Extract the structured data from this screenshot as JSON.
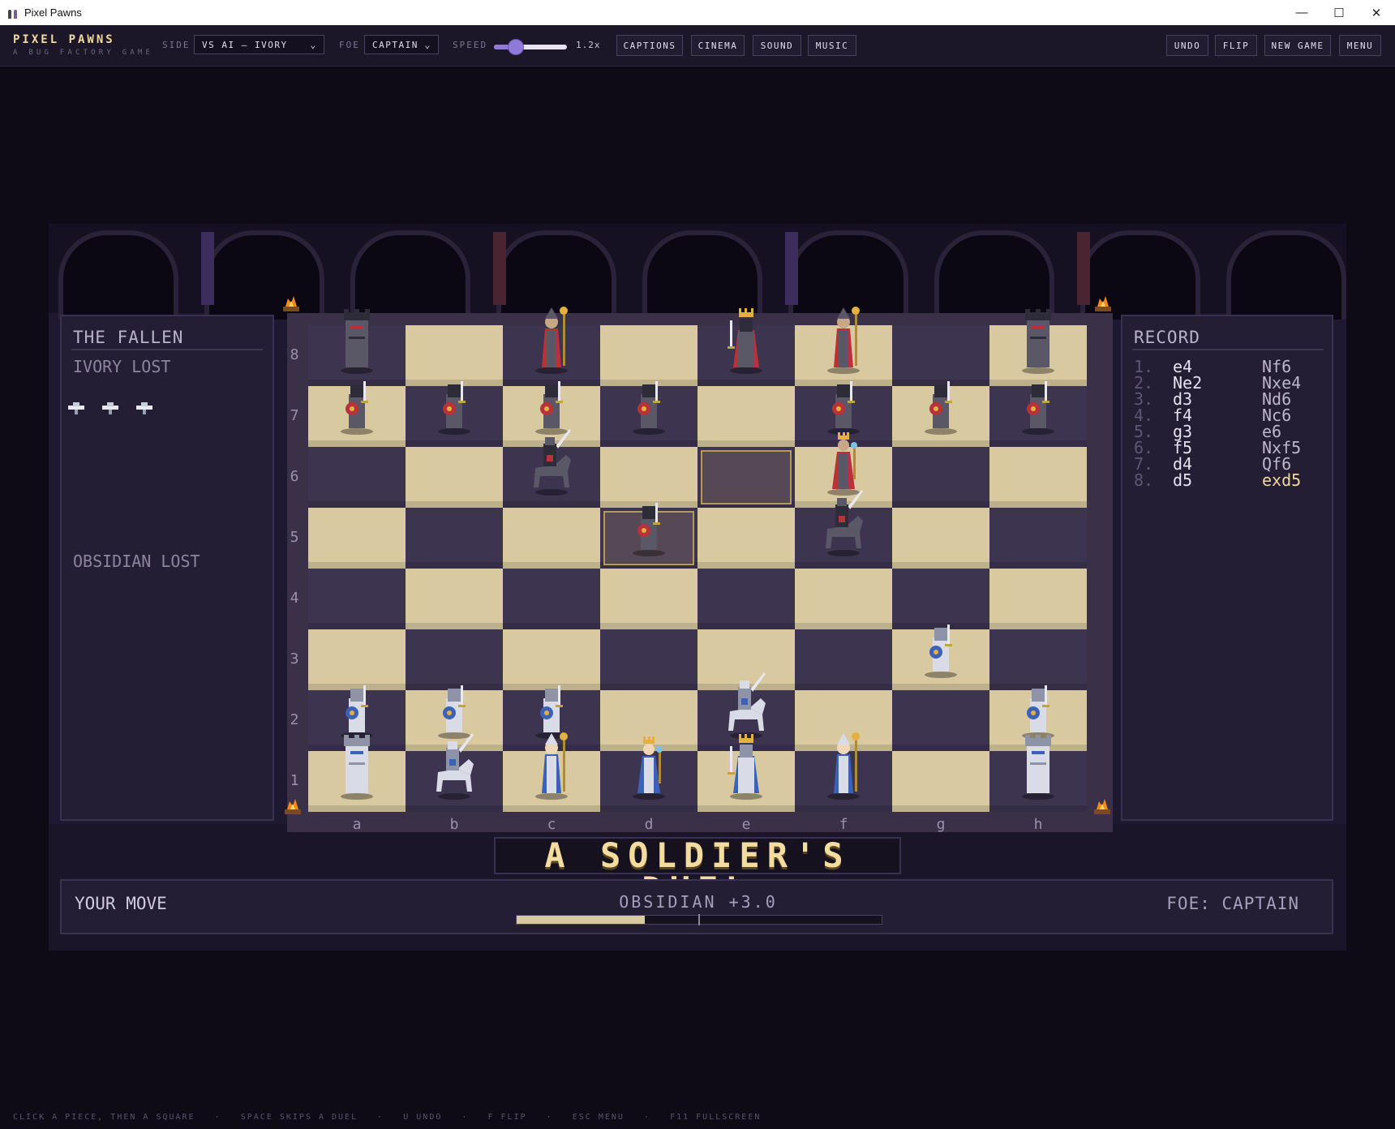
{
  "window": {
    "title": "Pixel Pawns"
  },
  "brand": {
    "name": "PIXEL PAWNS",
    "tagline": "A BUG FACTORY GAME"
  },
  "toolbar": {
    "side_label": "SIDE",
    "side_value": "VS AI — IVORY",
    "foe_label": "FOE",
    "foe_value": "CAPTAIN",
    "speed_label": "SPEED",
    "speed_value": "1.2x",
    "speed_fraction": 0.3,
    "captions": "CAPTIONS",
    "cinema": "CINEMA",
    "sound": "SOUND",
    "music": "MUSIC",
    "undo": "UNDO",
    "flip": "FLIP",
    "new_game": "NEW GAME",
    "menu": "MENU"
  },
  "fallen": {
    "title": "THE FALLEN",
    "ivory_lost": "IVORY LOST",
    "obsidian_lost": "OBSIDIAN LOST",
    "ivory_lost_pawns": 3
  },
  "record": {
    "title": "RECORD",
    "moves": [
      {
        "n": "1.",
        "w": "e4",
        "b": "Nf6"
      },
      {
        "n": "2.",
        "w": "Ne2",
        "b": "Nxe4"
      },
      {
        "n": "3.",
        "w": "d3",
        "b": "Nd6"
      },
      {
        "n": "4.",
        "w": "f4",
        "b": "Nc6"
      },
      {
        "n": "5.",
        "w": "g3",
        "b": "e6"
      },
      {
        "n": "6.",
        "w": "f5",
        "b": "Nxf5"
      },
      {
        "n": "7.",
        "w": "d4",
        "b": "Qf6"
      },
      {
        "n": "8.",
        "w": "d5",
        "b": "exd5"
      }
    ]
  },
  "board": {
    "files": [
      "a",
      "b",
      "c",
      "d",
      "e",
      "f",
      "g",
      "h"
    ],
    "ranks": [
      "8",
      "7",
      "6",
      "5",
      "4",
      "3",
      "2",
      "1"
    ],
    "pieces": [
      {
        "color": "black",
        "type": "rook",
        "sq": "a8"
      },
      {
        "color": "black",
        "type": "bishop",
        "sq": "c8"
      },
      {
        "color": "black",
        "type": "king",
        "sq": "e8"
      },
      {
        "color": "black",
        "type": "bishop",
        "sq": "f8"
      },
      {
        "color": "black",
        "type": "rook",
        "sq": "h8"
      },
      {
        "color": "black",
        "type": "pawn",
        "sq": "a7"
      },
      {
        "color": "black",
        "type": "pawn",
        "sq": "b7"
      },
      {
        "color": "black",
        "type": "pawn",
        "sq": "c7"
      },
      {
        "color": "black",
        "type": "pawn",
        "sq": "d7"
      },
      {
        "color": "black",
        "type": "pawn",
        "sq": "f7"
      },
      {
        "color": "black",
        "type": "pawn",
        "sq": "g7"
      },
      {
        "color": "black",
        "type": "pawn",
        "sq": "h7"
      },
      {
        "color": "black",
        "type": "knight",
        "sq": "c6"
      },
      {
        "color": "black",
        "type": "queen",
        "sq": "f6"
      },
      {
        "color": "black",
        "type": "knight",
        "sq": "f5"
      },
      {
        "color": "black",
        "type": "pawn",
        "sq": "d5"
      },
      {
        "color": "white",
        "type": "pawn",
        "sq": "g3"
      },
      {
        "color": "white",
        "type": "knight",
        "sq": "e2"
      },
      {
        "color": "white",
        "type": "pawn",
        "sq": "a2"
      },
      {
        "color": "white",
        "type": "pawn",
        "sq": "b2"
      },
      {
        "color": "white",
        "type": "pawn",
        "sq": "c2"
      },
      {
        "color": "white",
        "type": "pawn",
        "sq": "h2"
      },
      {
        "color": "white",
        "type": "rook",
        "sq": "a1"
      },
      {
        "color": "white",
        "type": "knight",
        "sq": "b1"
      },
      {
        "color": "white",
        "type": "bishop",
        "sq": "c1"
      },
      {
        "color": "white",
        "type": "queen",
        "sq": "d1"
      },
      {
        "color": "white",
        "type": "king",
        "sq": "e1"
      },
      {
        "color": "white",
        "type": "bishop",
        "sq": "f1"
      },
      {
        "color": "white",
        "type": "rook",
        "sq": "h1"
      }
    ],
    "highlights": [
      "e6",
      "d5"
    ]
  },
  "duel": {
    "caption": "A SOLDIER'S DUEL"
  },
  "status": {
    "turn": "YOUR MOVE",
    "eval": "OBSIDIAN +3.0",
    "eval_fraction": 0.35,
    "foe": "FOE: CAPTAIN"
  },
  "footer": {
    "hints": "CLICK A PIECE, THEN A SQUARE   ·   SPACE SKIPS A DUEL   ·   U UNDO   ·   F FLIP   ·   ESC MENU   ·   F11 FULLSCREEN"
  },
  "colors": {
    "accent": "#8f79d9",
    "light_square": "#d8c9a0",
    "dark_square": "#3d3450",
    "gold": "#f1d9a0"
  }
}
